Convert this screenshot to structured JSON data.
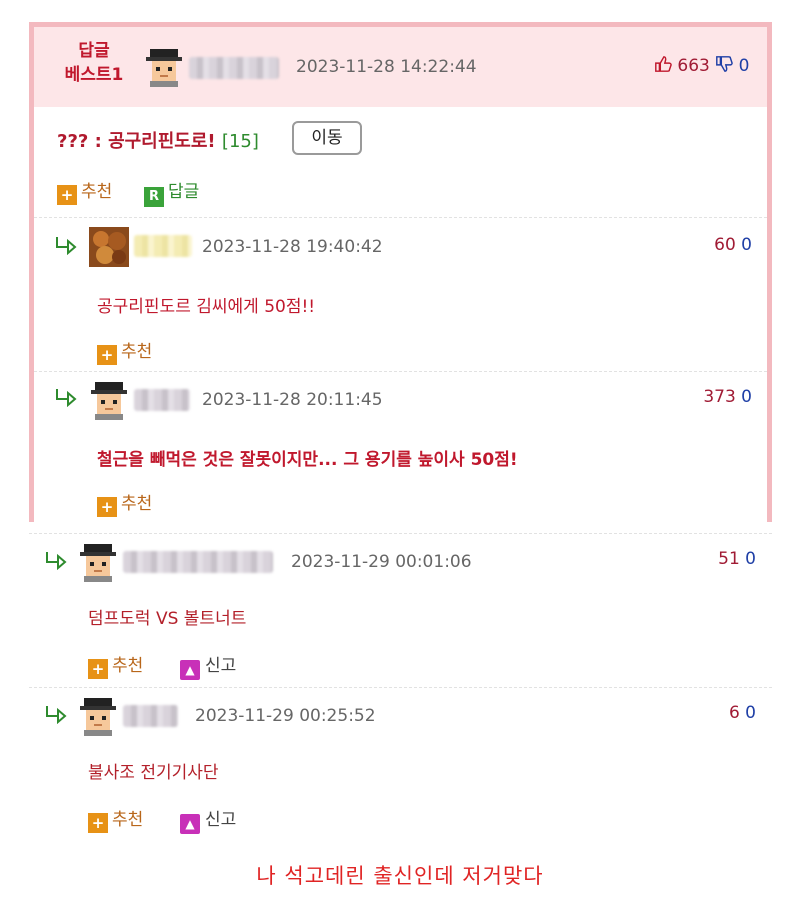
{
  "best": {
    "label_line1": "답글",
    "label_line2": "베스트1",
    "timestamp": "2023-11-28 14:22:44",
    "up_count": "663",
    "down_count": "0",
    "title_prefix": "??? : ",
    "title": "공구리핀도로!",
    "reply_count": "[15]",
    "move_button": "이동",
    "recommend_label": "추천",
    "reply_label": "답글",
    "reply_icon_letter": "R"
  },
  "replies": [
    {
      "timestamp": "2023-11-28 19:40:42",
      "up": "60",
      "down": "0",
      "text": "공구리핀도르 김씨에게 50점!!",
      "recommend_label": "추천"
    },
    {
      "timestamp": "2023-11-28 20:11:45",
      "up": "373",
      "down": "0",
      "text": "철근을 빼먹은 것은 잘못이지만... 그 용기를 높이사 50점!",
      "recommend_label": "추천"
    },
    {
      "timestamp": "2023-11-29 00:01:06",
      "up": "51",
      "down": "0",
      "text": "덤프도럭 VS 볼트너트",
      "recommend_label": "추천",
      "report_label": "신고"
    },
    {
      "timestamp": "2023-11-29 00:25:52",
      "up": "6",
      "down": "0",
      "text": "불사조 전기기사단",
      "recommend_label": "추천",
      "report_label": "신고"
    }
  ],
  "caption": "나 석고데린 출신인데 저거맞다",
  "colors": {
    "best_border": "#f3b9bf",
    "best_header_bg": "#fde6e8",
    "accent_red": "#c0182d",
    "green": "#2e8b2e",
    "orange": "#e79216"
  },
  "icons": [
    "thumbs-up-icon",
    "thumbs-down-icon",
    "plus-icon",
    "reply-r-icon",
    "reply-arrow-icon",
    "report-siren-icon",
    "avatar-icon"
  ]
}
